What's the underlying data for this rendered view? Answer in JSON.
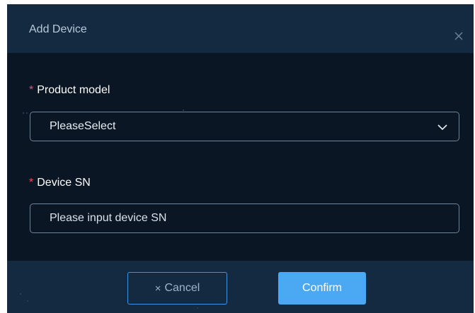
{
  "dialog": {
    "title": "Add Device",
    "close_icon": "close-icon"
  },
  "form": {
    "product_model": {
      "required_mark": "*",
      "label": "Product model",
      "selected_value": "PleaseSelect",
      "dropdown_icon": "chevron-down-icon"
    },
    "device_sn": {
      "required_mark": "*",
      "label": "Device SN",
      "value": "",
      "placeholder": "Please input device SN"
    }
  },
  "footer": {
    "cancel_icon": "×",
    "cancel_label": "Cancel",
    "confirm_label": "Confirm"
  },
  "colors": {
    "accent": "#4ba8f2",
    "required": "#e8534f",
    "background": "#0b1625",
    "header": "#132a40"
  }
}
